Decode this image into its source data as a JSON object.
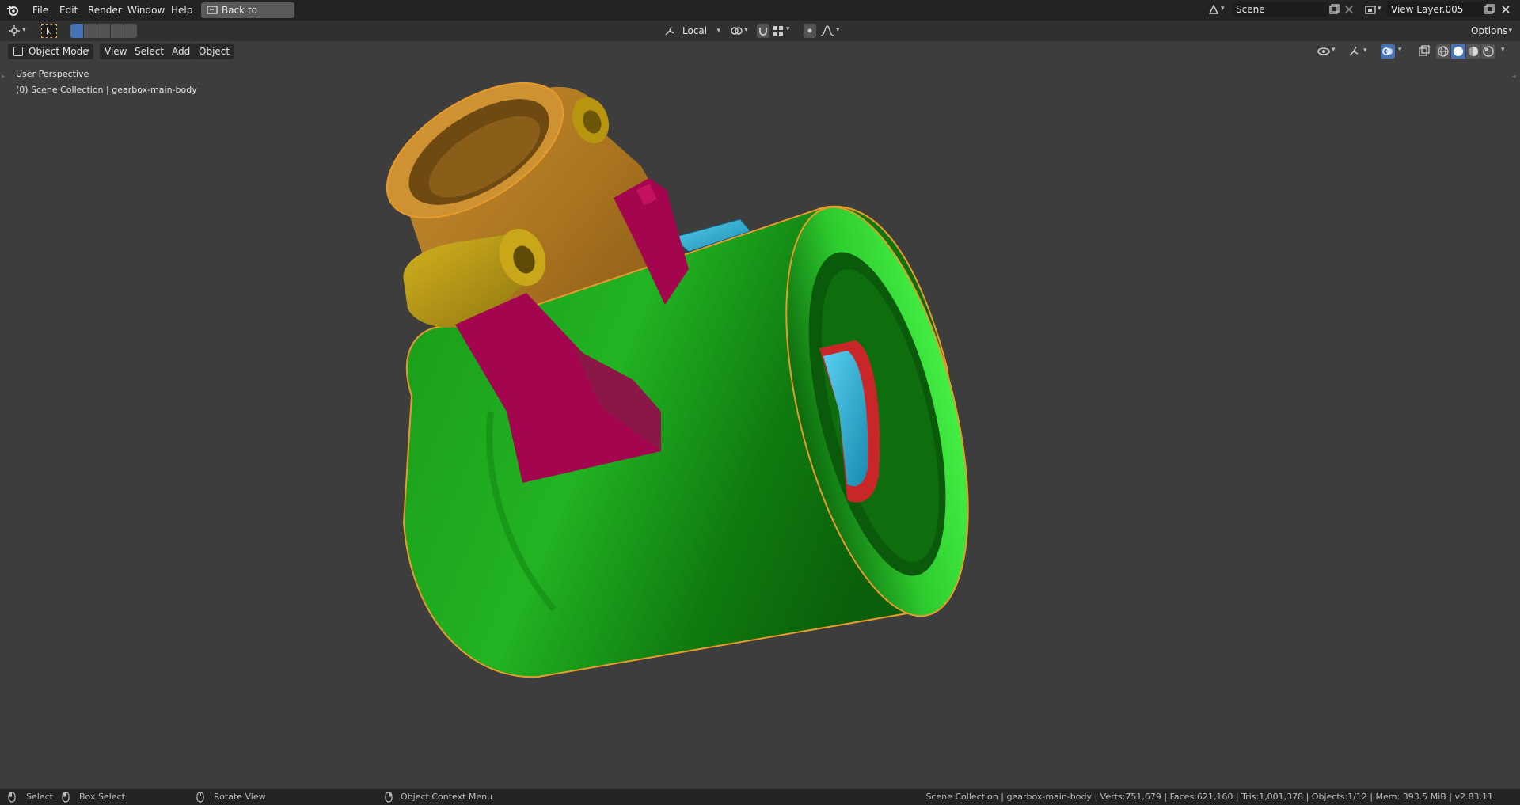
{
  "topbar": {
    "menus": [
      "File",
      "Edit",
      "Render",
      "Window",
      "Help"
    ],
    "back_label": "Back to Previous",
    "scene_name": "Scene",
    "view_layer": "View Layer.005"
  },
  "toolrow": {
    "orientation": "Local",
    "options_label": "Options"
  },
  "header": {
    "mode": "Object Mode",
    "menus": [
      "View",
      "Select",
      "Add",
      "Object"
    ]
  },
  "viewport": {
    "perspective": "User Perspective",
    "collection": "(0) Scene Collection | gearbox-main-body",
    "outline_color": "#e89a2a"
  },
  "statusbar": {
    "select": "Select",
    "box_select": "Box Select",
    "rotate": "Rotate View",
    "context": "Object Context Menu",
    "stats": "Scene Collection | gearbox-main-body | Verts:751,679 | Faces:621,160 | Tris:1,001,378 | Objects:1/12 | Mem: 393.5 MiB | v2.83.11"
  },
  "icons": [
    "blender-logo-icon",
    "back-icon",
    "scene-icon",
    "new-icon",
    "close-icon",
    "view-layer-icon",
    "editor-type-icon",
    "select-tool-icon",
    "mode-select-icon",
    "transform-orientation-icon",
    "pivot-icon",
    "snap-icon",
    "proportional-icon",
    "object-mode-icon",
    "visibility-icon",
    "gizmo-icon",
    "overlay-icon",
    "xray-icon",
    "wireframe-icon",
    "solid-icon",
    "material-icon",
    "rendered-icon",
    "mouse-icon"
  ]
}
